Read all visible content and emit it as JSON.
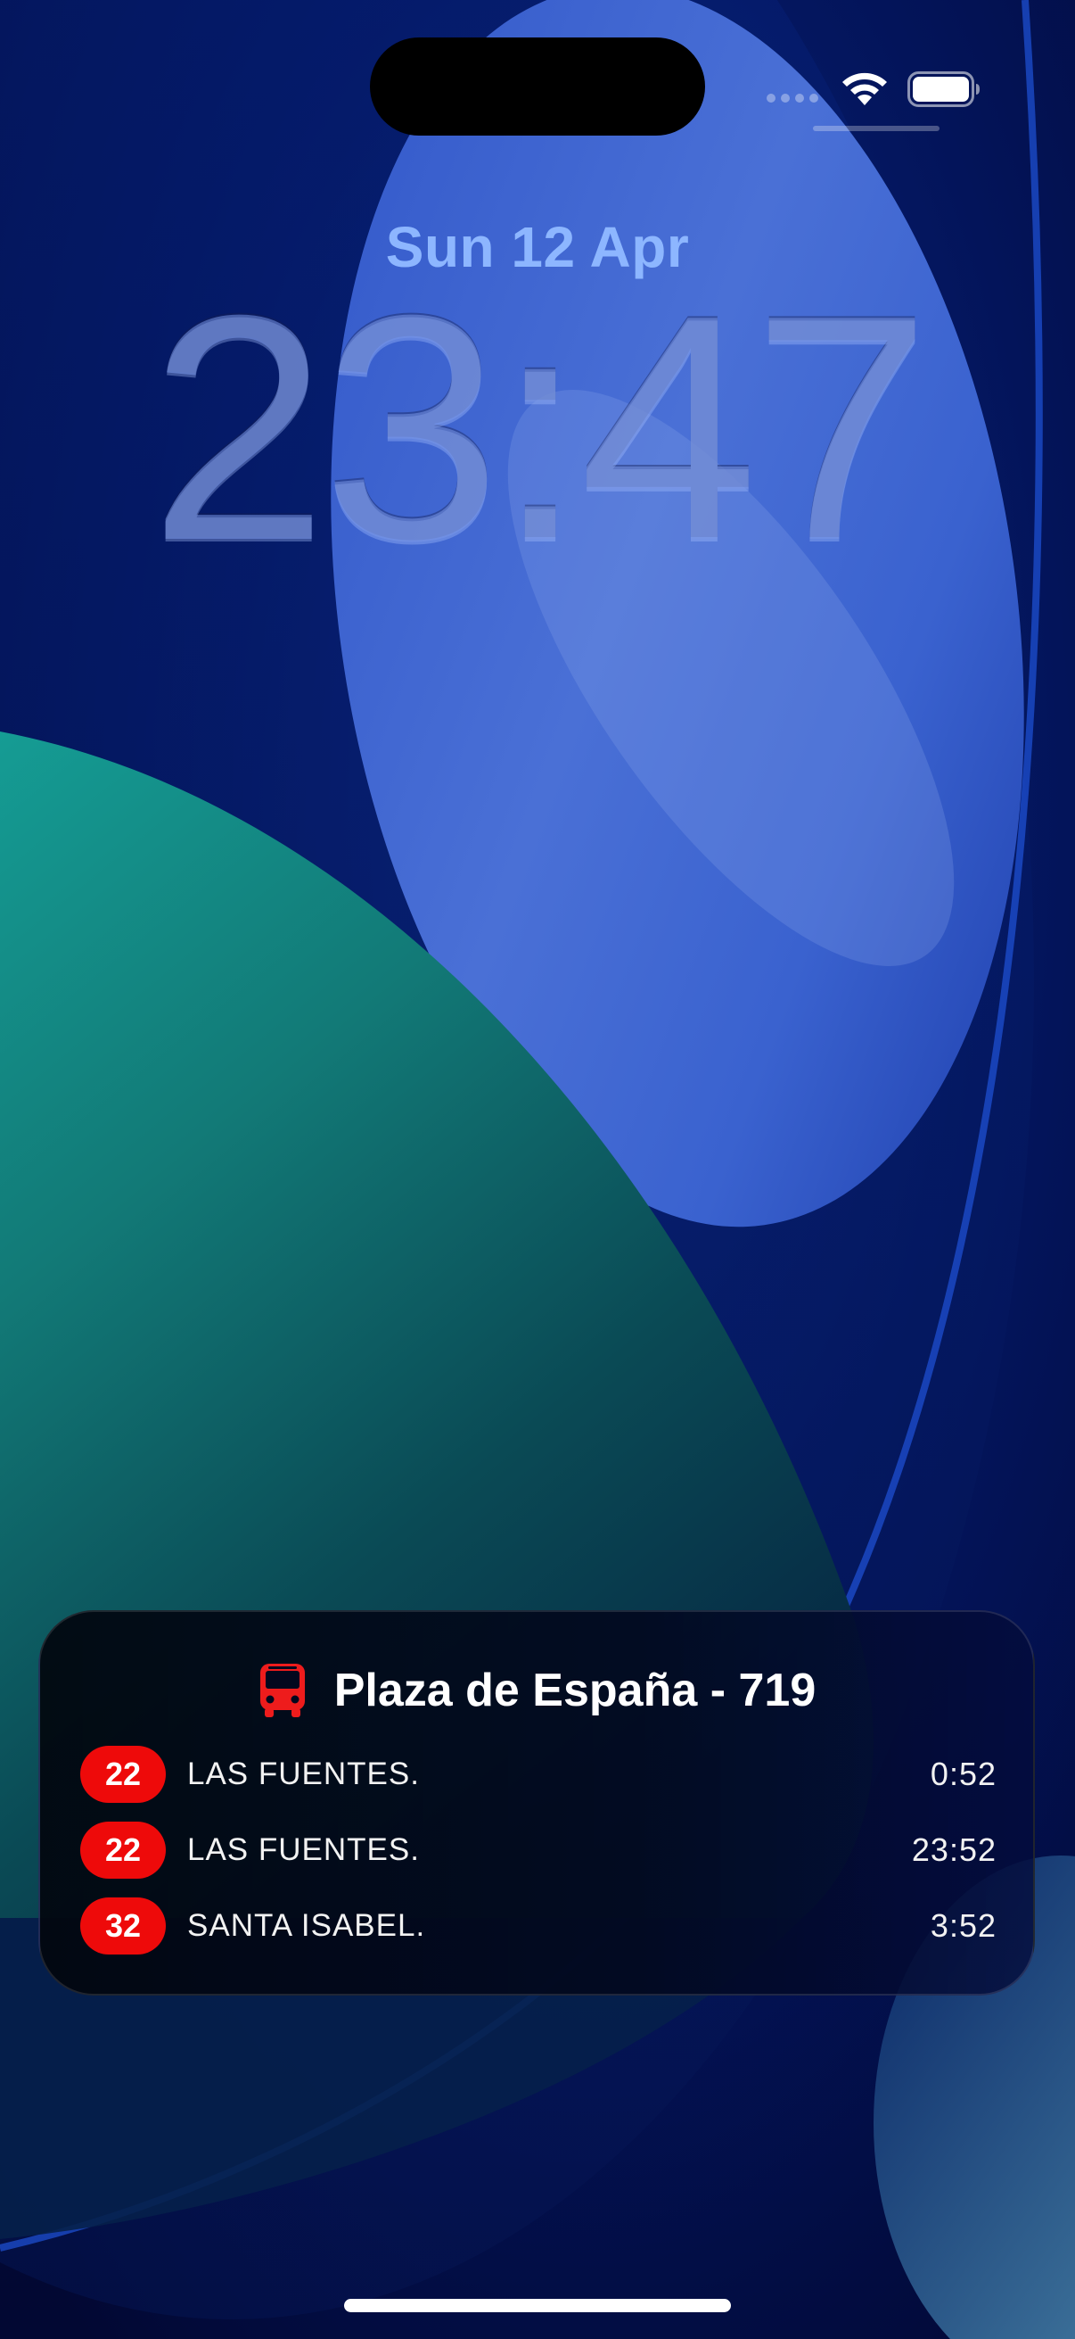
{
  "lock_screen": {
    "date": "Sun 12 Apr",
    "time": "23:47"
  },
  "status_bar": {
    "icons": [
      "cellular-signal-icon",
      "wifi-icon",
      "battery-icon"
    ]
  },
  "widget": {
    "icon": "bus-icon",
    "stop_title": "Plaza de España - 719",
    "departures": [
      {
        "line": "22",
        "destination": "LAS FUENTES.",
        "eta": "0:52"
      },
      {
        "line": "22",
        "destination": "LAS FUENTES.",
        "eta": "23:52"
      },
      {
        "line": "32",
        "destination": "SANTA ISABEL.",
        "eta": "3:52"
      }
    ]
  },
  "colors": {
    "date_text": "#8db6ff",
    "clock_text": "#7896e6",
    "line_badge": "#ee0a0a",
    "bus_icon": "#ee1c1c",
    "widget_background": "#03081e"
  }
}
